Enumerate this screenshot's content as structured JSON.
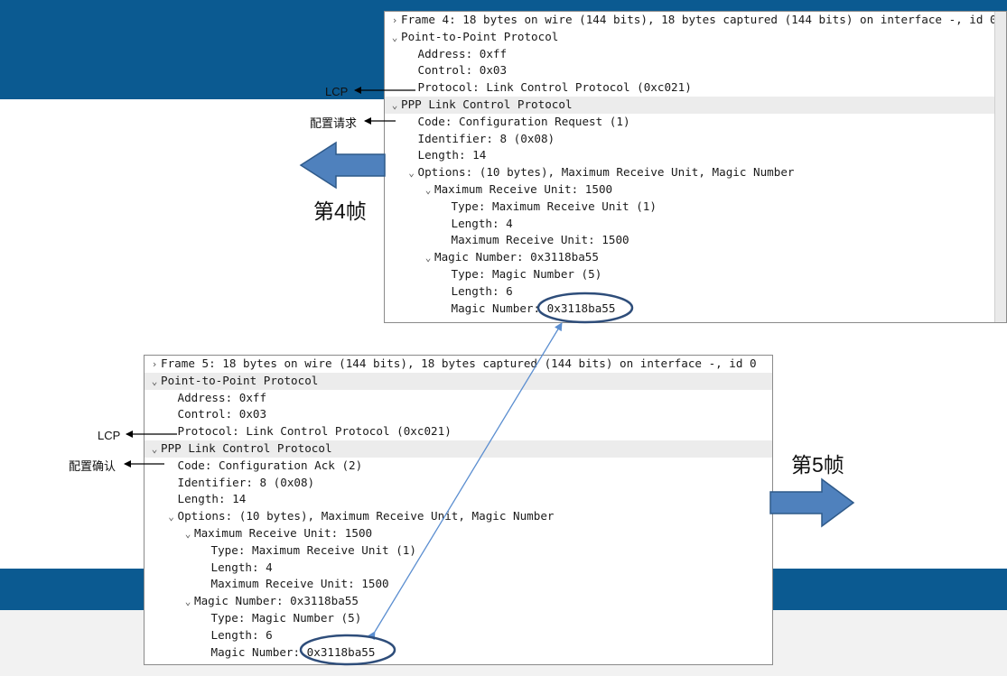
{
  "colors": {
    "band": "#0b5a91",
    "arrow_fill": "#4f81bd",
    "arrow_stroke": "#2f5a8a",
    "ellipse": "#2e4d7a",
    "connector": "#5b8ed0"
  },
  "frame4": {
    "rows": [
      {
        "level": 0,
        "toggle": "collapsed",
        "text": "Frame 4: 18 bytes on wire (144 bits), 18 bytes captured (144 bits) on interface -, id 0"
      },
      {
        "level": 0,
        "toggle": "expanded",
        "text": "Point-to-Point Protocol"
      },
      {
        "level": 1,
        "toggle": "none",
        "text": "Address: 0xff"
      },
      {
        "level": 1,
        "toggle": "none",
        "text": "Control: 0x03"
      },
      {
        "level": 1,
        "toggle": "none",
        "text": "Protocol: Link Control Protocol (0xc021)"
      },
      {
        "level": 0,
        "toggle": "expanded",
        "text": "PPP Link Control Protocol",
        "highlight": true
      },
      {
        "level": 1,
        "toggle": "none",
        "text": "Code: Configuration Request (1)"
      },
      {
        "level": 1,
        "toggle": "none",
        "text": "Identifier: 8 (0x08)"
      },
      {
        "level": 1,
        "toggle": "none",
        "text": "Length: 14"
      },
      {
        "level": 1,
        "toggle": "expanded",
        "text": "Options: (10 bytes), Maximum Receive Unit, Magic Number"
      },
      {
        "level": 2,
        "toggle": "expanded",
        "text": "Maximum Receive Unit: 1500"
      },
      {
        "level": 3,
        "toggle": "none",
        "text": "Type: Maximum Receive Unit (1)"
      },
      {
        "level": 3,
        "toggle": "none",
        "text": "Length: 4"
      },
      {
        "level": 3,
        "toggle": "none",
        "text": "Maximum Receive Unit: 1500"
      },
      {
        "level": 2,
        "toggle": "expanded",
        "text": "Magic Number: 0x3118ba55"
      },
      {
        "level": 3,
        "toggle": "none",
        "text": "Type: Magic Number (5)"
      },
      {
        "level": 3,
        "toggle": "none",
        "text": "Length: 6"
      },
      {
        "level": 3,
        "toggle": "none",
        "text": "Magic Number: 0x3118ba55"
      }
    ]
  },
  "frame5": {
    "rows": [
      {
        "level": 0,
        "toggle": "collapsed",
        "text": "Frame 5: 18 bytes on wire (144 bits), 18 bytes captured (144 bits) on interface -, id 0"
      },
      {
        "level": 0,
        "toggle": "expanded",
        "text": "Point-to-Point Protocol",
        "highlight": true
      },
      {
        "level": 1,
        "toggle": "none",
        "text": "Address: 0xff"
      },
      {
        "level": 1,
        "toggle": "none",
        "text": "Control: 0x03"
      },
      {
        "level": 1,
        "toggle": "none",
        "text": "Protocol: Link Control Protocol (0xc021)"
      },
      {
        "level": 0,
        "toggle": "expanded",
        "text": "PPP Link Control Protocol",
        "highlight": true
      },
      {
        "level": 1,
        "toggle": "none",
        "text": "Code: Configuration Ack (2)"
      },
      {
        "level": 1,
        "toggle": "none",
        "text": "Identifier: 8 (0x08)"
      },
      {
        "level": 1,
        "toggle": "none",
        "text": "Length: 14"
      },
      {
        "level": 1,
        "toggle": "expanded",
        "text": "Options: (10 bytes), Maximum Receive Unit, Magic Number"
      },
      {
        "level": 2,
        "toggle": "expanded",
        "text": "Maximum Receive Unit: 1500"
      },
      {
        "level": 3,
        "toggle": "none",
        "text": "Type: Maximum Receive Unit (1)"
      },
      {
        "level": 3,
        "toggle": "none",
        "text": "Length: 4"
      },
      {
        "level": 3,
        "toggle": "none",
        "text": "Maximum Receive Unit: 1500"
      },
      {
        "level": 2,
        "toggle": "expanded",
        "text": "Magic Number: 0x3118ba55"
      },
      {
        "level": 3,
        "toggle": "none",
        "text": "Type: Magic Number (5)"
      },
      {
        "level": 3,
        "toggle": "none",
        "text": "Length: 6"
      },
      {
        "level": 3,
        "toggle": "none",
        "text": "Magic Number: 0x3118ba55"
      }
    ]
  },
  "annotations": {
    "lcp_top": "LCP",
    "config_request": "配置请求",
    "frame4_title": "第4帧",
    "lcp_bottom": "LCP",
    "config_ack": "配置确认",
    "frame5_title": "第5帧"
  },
  "icons": {
    "collapsed": "chevron-right-icon",
    "expanded": "chevron-down-icon",
    "left_arrow": "big-left-arrow-icon",
    "right_arrow": "big-right-arrow-icon"
  }
}
